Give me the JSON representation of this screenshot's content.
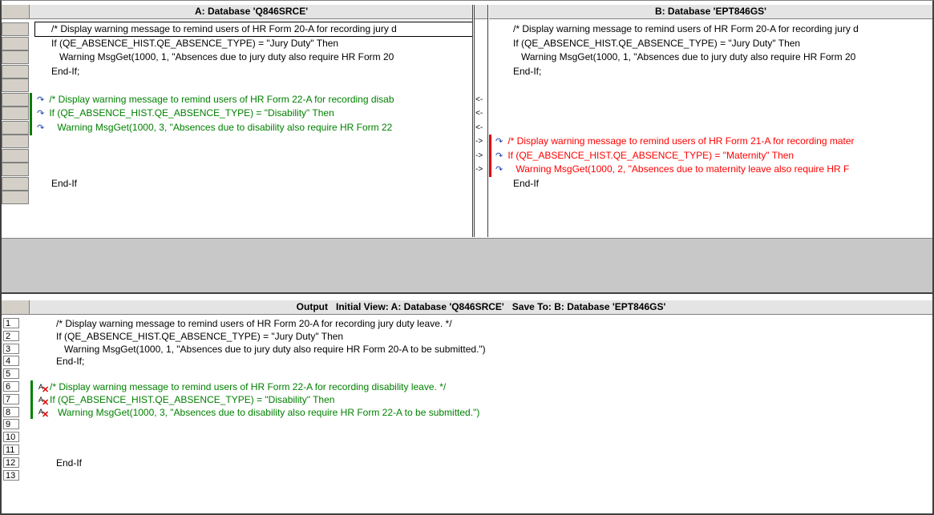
{
  "pane_a": {
    "title": "A: Database 'Q846SRCE'",
    "rows": [
      {
        "text": "/* Display warning message to remind users of HR Form 20-A for recording jury d",
        "type": "normal",
        "indent": 0,
        "icon": "",
        "selected": true
      },
      {
        "text": "If (QE_ABSENCE_HIST.QE_ABSENCE_TYPE) = \"Jury Duty\" Then",
        "type": "normal",
        "indent": 0,
        "icon": ""
      },
      {
        "text": "Warning MsgGet(1000, 1, \"Absences due to jury duty also require HR Form 20",
        "type": "normal",
        "indent": 1,
        "icon": ""
      },
      {
        "text": "End-If;",
        "type": "normal",
        "indent": 0,
        "icon": ""
      },
      {
        "text": "",
        "type": "normal",
        "indent": 0,
        "icon": ""
      },
      {
        "text": "/* Display warning message to remind users of HR Form 22-A for recording disab",
        "type": "green",
        "indent": 0,
        "icon": "↷"
      },
      {
        "text": "If (QE_ABSENCE_HIST.QE_ABSENCE_TYPE) = \"Disability\" Then",
        "type": "green",
        "indent": 0,
        "icon": "↷"
      },
      {
        "text": "Warning MsgGet(1000, 3, \"Absences due to disability also require HR Form 22",
        "type": "green",
        "indent": 1,
        "icon": "↷"
      },
      {
        "text": "",
        "type": "normal",
        "indent": 0,
        "icon": ""
      },
      {
        "text": "",
        "type": "normal",
        "indent": 0,
        "icon": ""
      },
      {
        "text": "",
        "type": "normal",
        "indent": 0,
        "icon": ""
      },
      {
        "text": "End-If",
        "type": "normal",
        "indent": 0,
        "icon": ""
      },
      {
        "text": "",
        "type": "normal",
        "indent": 0,
        "icon": ""
      }
    ]
  },
  "markers": [
    "",
    "",
    "",
    "",
    "",
    "<-",
    "<-",
    "<-",
    "->",
    "->",
    "->",
    "",
    ""
  ],
  "pane_b": {
    "title": "B: Database 'EPT846GS'",
    "rows": [
      {
        "text": "/* Display warning message to remind users of HR Form 20-A for recording jury d",
        "type": "normal",
        "indent": 0,
        "icon": ""
      },
      {
        "text": "If (QE_ABSENCE_HIST.QE_ABSENCE_TYPE) = \"Jury Duty\" Then",
        "type": "normal",
        "indent": 0,
        "icon": ""
      },
      {
        "text": "Warning MsgGet(1000, 1, \"Absences due to jury duty also require HR Form 20",
        "type": "normal",
        "indent": 1,
        "icon": ""
      },
      {
        "text": "End-If;",
        "type": "normal",
        "indent": 0,
        "icon": ""
      },
      {
        "text": "",
        "type": "normal",
        "indent": 0,
        "icon": ""
      },
      {
        "text": "",
        "type": "normal",
        "indent": 0,
        "icon": ""
      },
      {
        "text": "",
        "type": "normal",
        "indent": 0,
        "icon": ""
      },
      {
        "text": "",
        "type": "normal",
        "indent": 0,
        "icon": ""
      },
      {
        "text": "/* Display warning message to remind users of HR Form 21-A for recording mater",
        "type": "red",
        "indent": 0,
        "icon": "↷"
      },
      {
        "text": "If (QE_ABSENCE_HIST.QE_ABSENCE_TYPE) = \"Maternity\" Then",
        "type": "red",
        "indent": 0,
        "icon": "↷"
      },
      {
        "text": "Warning MsgGet(1000, 2, \"Absences due to maternity leave also require HR F",
        "type": "red",
        "indent": 1,
        "icon": "↷"
      },
      {
        "text": "End-If",
        "type": "normal",
        "indent": 0,
        "icon": ""
      }
    ]
  },
  "output": {
    "title": "Output   Initial View: A: Database 'Q846SRCE'   Save To: B: Database 'EPT846GS'",
    "rows": [
      {
        "num": "1",
        "text": "/* Display warning message to remind users of HR Form 20-A for recording jury duty leave. */",
        "type": "normal",
        "indent": 0,
        "icon": false
      },
      {
        "num": "2",
        "text": "If (QE_ABSENCE_HIST.QE_ABSENCE_TYPE) = \"Jury Duty\" Then",
        "type": "normal",
        "indent": 0,
        "icon": false
      },
      {
        "num": "3",
        "text": "Warning MsgGet(1000, 1, \"Absences due to jury duty also require HR Form 20-A to be submitted.\")",
        "type": "normal",
        "indent": 1,
        "icon": false
      },
      {
        "num": "4",
        "text": "End-If;",
        "type": "normal",
        "indent": 0,
        "icon": false
      },
      {
        "num": "5",
        "text": "",
        "type": "normal",
        "indent": 0,
        "icon": false
      },
      {
        "num": "6",
        "text": "/* Display warning message to remind users of HR Form 22-A for recording disability leave. */",
        "type": "green",
        "indent": 0,
        "icon": true
      },
      {
        "num": "7",
        "text": "If (QE_ABSENCE_HIST.QE_ABSENCE_TYPE) = \"Disability\" Then",
        "type": "green",
        "indent": 0,
        "icon": true
      },
      {
        "num": "8",
        "text": "Warning MsgGet(1000, 3, \"Absences due to disability also require HR Form 22-A to be submitted.\")",
        "type": "green",
        "indent": 1,
        "icon": true
      },
      {
        "num": "9",
        "text": "",
        "type": "normal",
        "indent": 0,
        "icon": false
      },
      {
        "num": "10",
        "text": "",
        "type": "normal",
        "indent": 0,
        "icon": false
      },
      {
        "num": "11",
        "text": "",
        "type": "normal",
        "indent": 0,
        "icon": false
      },
      {
        "num": "12",
        "text": "End-If",
        "type": "normal",
        "indent": 0,
        "icon": false
      },
      {
        "num": "13",
        "text": "",
        "type": "normal",
        "indent": 0,
        "icon": false
      }
    ]
  },
  "colors": {
    "added_green": "#008000",
    "removed_red": "#ff0000",
    "gutter_gray": "#d4d0c8",
    "splitter_gray": "#c8c8c8"
  }
}
